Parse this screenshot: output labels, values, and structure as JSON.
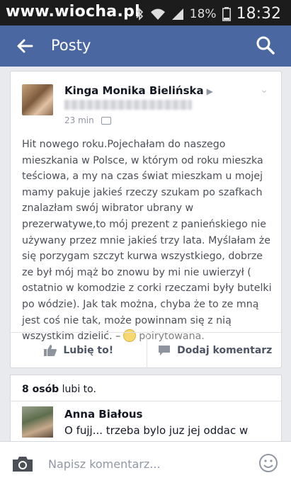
{
  "statusbar": {
    "watermark": "www.wiocha.pl",
    "battery": "18%",
    "time": "18:32"
  },
  "appbar": {
    "title": "Posty"
  },
  "post": {
    "author": "Kinga Monika Bielińska",
    "timestamp": "23 min",
    "text": "Hit nowego roku.Pojechałam do naszego mieszkania w Polsce, w którym od roku mieszka teściowa, a my na czas świat mieszkam u mojej mamy pakuje jakieś rzeczy szukam po szafkach znalazłam swój wibrator ubrany w prezerwatywe,to mój prezent z panieńskiego nie używany przez mnie jakieś trzy lata. Myślałam że się porzygam szczyt kurwa wszystkiego, dobrze ze był mój mąż bo znowu by mi nie uwierzył ( ostatnio w komodzie z corki rzeczami były butelki po wódzie). Jak tak można, chyba że to ze mną jest coś nie tak, może powinnam się z nią wszystkim dzielić. –",
    "feeling": "poirytowana.",
    "like_label": "Lubię to!",
    "comment_label": "Dodaj komentarz"
  },
  "likes": {
    "count": "8 osób",
    "suffix": " lubi to."
  },
  "comment": {
    "author": "Anna Białous",
    "text": "O fujj... trzeba bylo juz jej oddac w"
  },
  "composer": {
    "placeholder": "Napisz komentarz..."
  },
  "colors": {
    "appbar": "#4b67a1",
    "statusbar": "#1c1c1c"
  }
}
